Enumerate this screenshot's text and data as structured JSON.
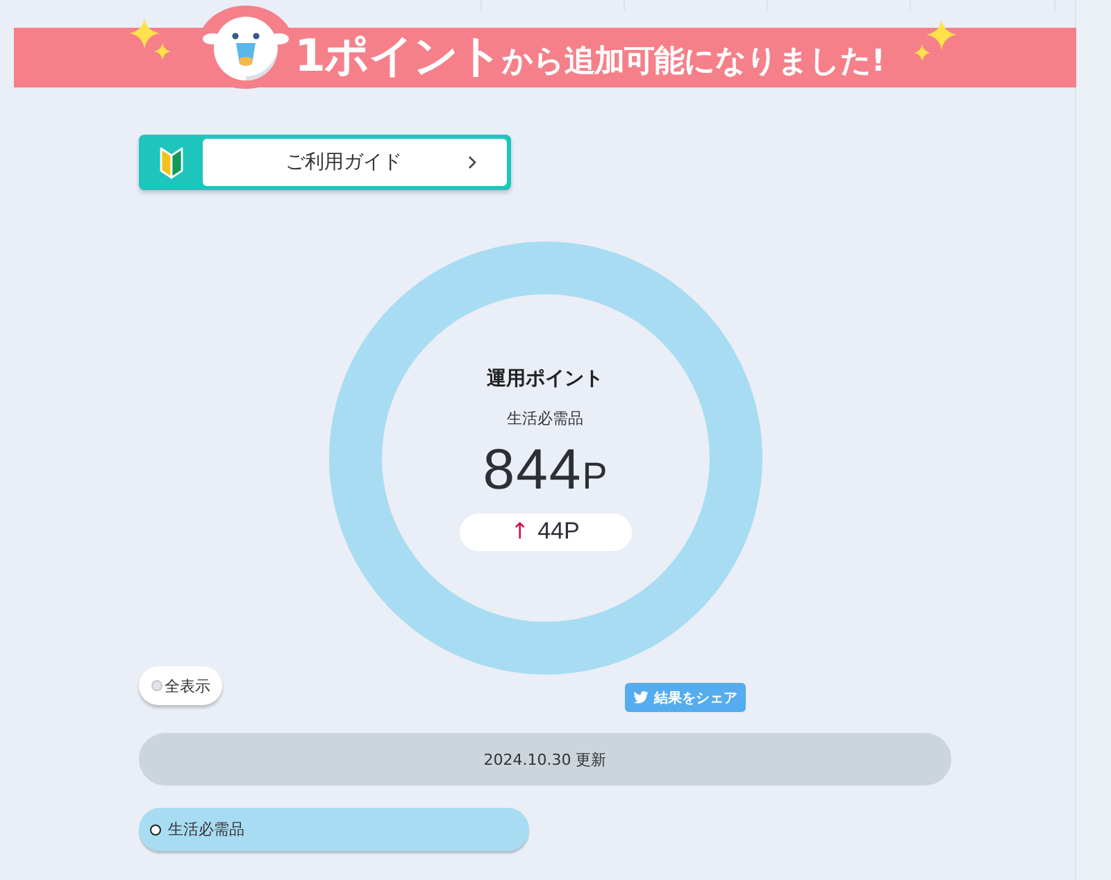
{
  "banner": {
    "text": "**1ポイント**から追加可能になりました!"
  },
  "guide_button": {
    "label": "ご利用ガイド"
  },
  "summary": {
    "title": "運用ポイント",
    "category": "生活必需品",
    "points": "844",
    "unit": "P",
    "change": {
      "arrow": "↑",
      "amount": "44P"
    }
  },
  "show_all": {
    "label": "全表示",
    "selected": false
  },
  "share_button": {
    "label": "結果をシェア"
  },
  "updated": {
    "text": "2024.10.30 更新"
  },
  "legend": [
    {
      "label": "生活必需品",
      "color": "#a8dcf2",
      "selected": true
    }
  ]
}
